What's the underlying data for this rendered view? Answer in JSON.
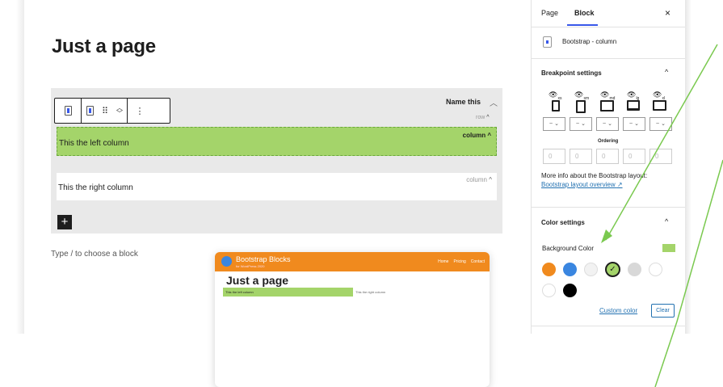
{
  "editor": {
    "page_title": "Just a page",
    "row_block": {
      "name": "Name this",
      "tag": "row",
      "left_column": {
        "text": "This the left column",
        "tag": "column"
      },
      "right_column": {
        "text": "This the right column",
        "tag": "column"
      }
    },
    "block_hint": "Type / to choose a block"
  },
  "toolbar": {
    "drag_glyph": "⠿",
    "more_glyph": "⋮"
  },
  "preview": {
    "brand": "Bootstrap Blocks",
    "subtitle": "for WordPress 2020",
    "nav": [
      "Home",
      "Pricing",
      "Contact"
    ],
    "title": "Just a page",
    "left_text": "This the left column",
    "right_text": "This the right column",
    "colors": {
      "header": "#f08a1e",
      "logo": "#3a86e0",
      "column": "#a4d46a"
    }
  },
  "sidebar": {
    "tabs": [
      "Page",
      "Block"
    ],
    "active_tab": "Block",
    "close_glyph": "×",
    "block_name": "Bootstrap - column",
    "breakpoint_title": "Breakpoint settings",
    "breakpoints": [
      "xs",
      "sm",
      "md",
      "lg",
      "xl"
    ],
    "select_value": "~",
    "ordering_label": "Ordering",
    "ordering_values": [
      "0",
      "0",
      "0",
      "0",
      "0"
    ],
    "info_text": "More info about the Bootstrap layout:",
    "info_link": "Bootstrap layout overview",
    "color_title": "Color settings",
    "background_label": "Background Color",
    "background_value": "#a4d46a",
    "palette": [
      "#f08a1e",
      "#3a86e0",
      "#f2f2f2",
      "#a4d46a",
      "#d8d8d8",
      "#ffffff",
      "#ffffff",
      "#000000"
    ],
    "selected_color_index": 3,
    "custom_color_label": "Custom color",
    "clear_label": "Clear"
  },
  "colors": {
    "accent": "#3858e9",
    "link": "#2271b1",
    "annotation_line": "#7ac94f"
  }
}
